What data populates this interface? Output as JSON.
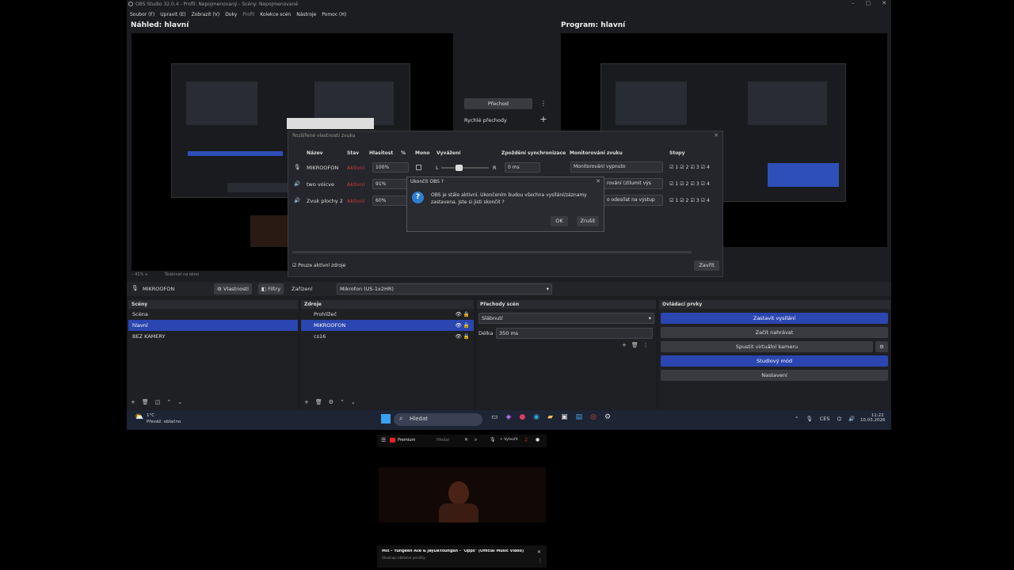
{
  "window": {
    "title": "OBS Studio 32.0.4 - Profil: Nepojmenovaný - Scény: Nepojmenované",
    "controls": [
      "–",
      "▢",
      "✕"
    ]
  },
  "menu": [
    "Soubor (F)",
    "Upravit (E)",
    "Zobrazit (V)",
    "Doky",
    "Profil",
    "Kolekce scén",
    "Nástroje",
    "Pomoc (H)"
  ],
  "preview": {
    "label": "Náhled: hlavní",
    "program_label": "Program: hlavní"
  },
  "transition": {
    "button": "Přechod",
    "quick": "Rychlé přechody"
  },
  "preview_footer": {
    "zoom": "– 41%  +",
    "scale": "Škálovat na okno"
  },
  "advanced_audio": {
    "title": "Rozšířené vlastnosti zvuku",
    "headers": {
      "name": "Název",
      "status": "Stav",
      "volume": "Hlasitost",
      "percent": "%",
      "mono": "Mono",
      "balance": "Vyvážení",
      "sync": "Zpoždění synchronizace",
      "monitoring": "Monitorování zvuku",
      "tracks": "Stopy"
    },
    "rows": [
      {
        "name": "MIKROOFON",
        "status": "Aktivní",
        "volume": "100%",
        "balance_l": "L",
        "balance_r": "R",
        "sync": "0 ms",
        "monitoring": "Monitorování vypnuto"
      },
      {
        "name": "two voicve",
        "status": "Aktivní",
        "volume": "91%",
        "monitoring": "rování (ztlumit výs"
      },
      {
        "name": "Zvuk plochy 2",
        "status": "Aktivní",
        "volume": "60%",
        "monitoring": "o odesílat na výstup"
      }
    ],
    "track_numbers": [
      "1",
      "2",
      "3",
      "4"
    ],
    "only_active": "Pouze aktivní zdroje",
    "close": "Zavřít"
  },
  "quit_dialog": {
    "title": "Ukončit OBS ?",
    "message_line1": "OBS je stále aktivní. Ukončením budou všechna vysílání/záznamy",
    "message_line2": "zastavena. Jste si jisti skončit ?",
    "ok": "OK",
    "cancel": "Zrušit"
  },
  "source_toolbar": {
    "source": "MIKROOFON",
    "properties": "Vlastnosti",
    "filters": "Filtry",
    "device_label": "Zařízení",
    "device_value": "Mikrofon (US-1x2HR)"
  },
  "docks": {
    "scenes": {
      "title": "Scény",
      "items": [
        "Scéna",
        "hlavní",
        "BEZ KAMERY"
      ],
      "selected": 1
    },
    "sources": {
      "title": "Zdroje",
      "items": [
        "Prohlížeč",
        "MIKROOFON",
        "cs16"
      ],
      "selected": 1
    },
    "transitions": {
      "title": "Přechody scén",
      "type": "Slábnutí",
      "duration_label": "Délka",
      "duration": "350 ms"
    },
    "controls": {
      "title": "Ovládací prvky",
      "buttons": [
        "Zastavit vysílání",
        "Začít nahrávat",
        "Spustit virtuální kameru",
        "Studiový mód",
        "Nastavení"
      ]
    }
  },
  "taskbar": {
    "weather_temp": "1°C",
    "weather_desc": "Převáž. oblačno",
    "search": "Hledat",
    "lang": "CES",
    "time": "11:22",
    "date": "10.03.2026"
  },
  "phone": {
    "app": "Premium",
    "search": "Hledat",
    "create": "+ Vytvořit",
    "video_title": "Mix – Yungeen Ace & JayDaYoungan - \"Opps\" (Official Music Video)",
    "video_sub": "Obsahuje oblíbené písničky"
  },
  "colors": {
    "accent": "#2b46b0",
    "status_red": "#c83a3a",
    "bg": "#1c1d20"
  }
}
